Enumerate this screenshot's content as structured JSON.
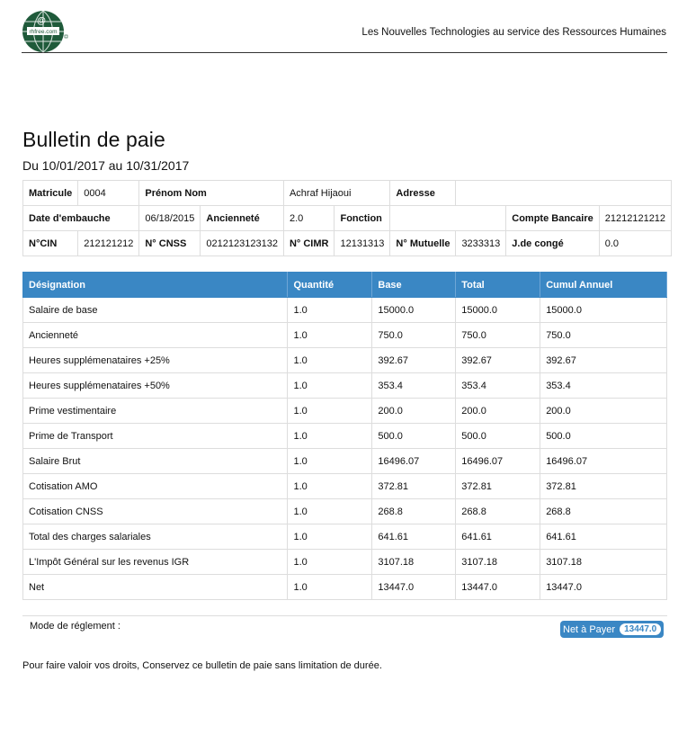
{
  "header": {
    "logo_text": "rhfree.com",
    "logo_symbol": "@",
    "tagline": "Les Nouvelles Technologies au service des Ressources Humaines"
  },
  "document": {
    "title": "Bulletin de paie",
    "period": "Du 10/01/2017 au 10/31/2017"
  },
  "employee": {
    "rows": [
      [
        {
          "text": "Matricule",
          "label": true
        },
        {
          "text": "0004"
        },
        {
          "text": "Prénom Nom",
          "label": true,
          "colspan": 2
        },
        {
          "text": "Achraf Hijaoui",
          "colspan": 2
        },
        {
          "text": "Adresse",
          "label": true
        },
        {
          "text": "",
          "colspan": 3
        }
      ],
      [
        {
          "text": "Date d'embauche",
          "label": true,
          "colspan": 2
        },
        {
          "text": "06/18/2015"
        },
        {
          "text": "Ancienneté",
          "label": true
        },
        {
          "text": "2.0"
        },
        {
          "text": "Fonction",
          "label": true
        },
        {
          "text": "",
          "colspan": 2
        },
        {
          "text": "Compte Bancaire",
          "label": true
        },
        {
          "text": "21212121212",
          "colspan": 2
        }
      ],
      [
        {
          "text": "N°CIN",
          "label": true
        },
        {
          "text": "212121212"
        },
        {
          "text": "N° CNSS",
          "label": true
        },
        {
          "text": "0212123123132"
        },
        {
          "text": "N° CIMR",
          "label": true
        },
        {
          "text": "12131313"
        },
        {
          "text": "N° Mutuelle",
          "label": true
        },
        {
          "text": "3233313"
        },
        {
          "text": "J.de congé",
          "label": true
        },
        {
          "text": "0.0"
        }
      ]
    ]
  },
  "payroll": {
    "headers": [
      "Désignation",
      "Quantité",
      "Base",
      "Total",
      "Cumul Annuel"
    ],
    "rows": [
      [
        "Salaire de base",
        "1.0",
        "15000.0",
        "15000.0",
        "15000.0"
      ],
      [
        "Ancienneté",
        "1.0",
        "750.0",
        "750.0",
        "750.0"
      ],
      [
        "Heures supplémenataires +25%",
        "1.0",
        "392.67",
        "392.67",
        "392.67"
      ],
      [
        "Heures supplémenataires +50%",
        "1.0",
        "353.4",
        "353.4",
        "353.4"
      ],
      [
        "Prime vestimentaire",
        "1.0",
        "200.0",
        "200.0",
        "200.0"
      ],
      [
        "Prime de Transport",
        "1.0",
        "500.0",
        "500.0",
        "500.0"
      ],
      [
        "Salaire Brut",
        "1.0",
        "16496.07",
        "16496.07",
        "16496.07"
      ],
      [
        "Cotisation AMO",
        "1.0",
        "372.81",
        "372.81",
        "372.81"
      ],
      [
        "Cotisation CNSS",
        "1.0",
        "268.8",
        "268.8",
        "268.8"
      ],
      [
        "Total des charges salariales",
        "1.0",
        "641.61",
        "641.61",
        "641.61"
      ],
      [
        "L'Impôt Général sur les revenus IGR",
        "1.0",
        "3107.18",
        "3107.18",
        "3107.18"
      ],
      [
        "Net",
        "1.0",
        "13447.0",
        "13447.0",
        "13447.0"
      ]
    ]
  },
  "footer": {
    "mode_label": "Mode de réglement :",
    "net_label": "Net à Payer",
    "net_value": "13447.0",
    "notice": "Pour faire valoir vos droits, Conservez ce bulletin de paie sans limitation de durée."
  },
  "colors": {
    "accent": "#3a87c4",
    "logo_green": "#1f5a3a",
    "border": "#dddddd"
  }
}
